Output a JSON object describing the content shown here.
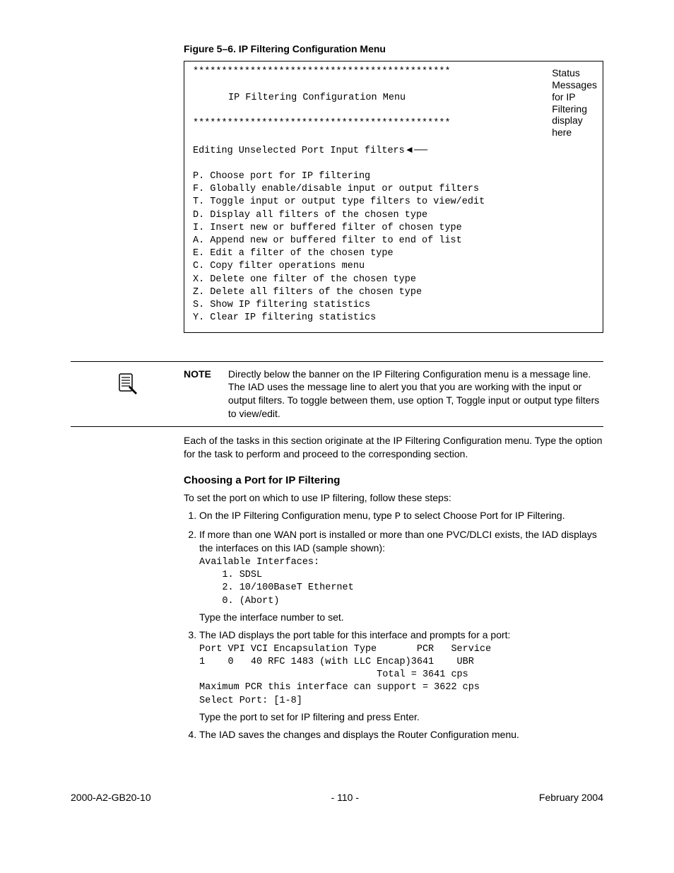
{
  "figure": {
    "caption": "Figure 5–6.  IP Filtering Configuration Menu",
    "stars": "*********************************************",
    "menuTitle": "IP Filtering Configuration Menu",
    "editing": "Editing Unselected Port Input filters",
    "annotation": "Status Messages for IP Filtering display here",
    "items": {
      "p": "P. Choose port for IP filtering",
      "f": "F. Globally enable/disable input or output filters",
      "t": "T. Toggle input or output type filters to view/edit",
      "d": "D. Display all filters of the chosen type",
      "i": "I. Insert new or buffered filter of chosen type",
      "a": "A. Append new or buffered filter to end of list",
      "e": "E. Edit a filter of the chosen type",
      "c": "C. Copy filter operations menu",
      "x": "X. Delete one filter of the chosen type",
      "z": "Z. Delete all filters of the chosen type",
      "s": "S. Show IP filtering statistics",
      "y": "Y. Clear IP filtering statistics"
    }
  },
  "note": {
    "label": "NOTE",
    "text": "Directly below the banner on the IP Filtering Configuration menu is a message line. The IAD uses the message line to alert you that you are working with the input or output filters. To toggle between them, use option T, Toggle input or output type filters to view/edit."
  },
  "intro": "Each of the tasks in this section originate at the IP Filtering Configuration menu. Type the option for the task to perform and proceed to the corresponding section.",
  "section": {
    "title": "Choosing a Port for IP Filtering",
    "lead": "To set the port on which to use IP filtering, follow these steps:"
  },
  "steps": {
    "s1a": "On the IP Filtering Configuration menu, type ",
    "s1key": "P",
    "s1b": " to select Choose Port for IP Filtering.",
    "s2": "If more than one WAN port is installed or more than one PVC/DLCI exists, the IAD displays the interfaces on this IAD (sample shown):",
    "s2block": "Available Interfaces:\n    1. SDSL\n    2. 10/100BaseT Ethernet\n    0. (Abort)",
    "s2after": "Type the interface number to set.",
    "s3": "The IAD displays the port table for this interface and prompts for a port:",
    "s3block": "Port VPI VCI Encapsulation Type       PCR   Service\n1    0   40 RFC 1483 (with LLC Encap)3641    UBR\n                               Total = 3641 cps\nMaximum PCR this interface can support = 3622 cps\nSelect Port: [1-8]",
    "s3after": "Type the port to set for IP filtering and press Enter.",
    "s4": "The IAD saves the changes and displays the Router Configuration menu."
  },
  "footer": {
    "left": "2000-A2-GB20-10",
    "center": "- 110 -",
    "right": "February 2004"
  }
}
